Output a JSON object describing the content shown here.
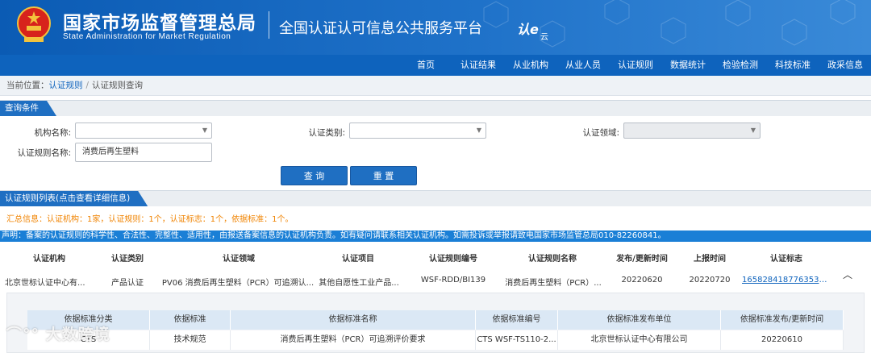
{
  "header": {
    "title_cn": "国家市场监督管理总局",
    "title_en": "State Administration  for  Market Regulation",
    "platform": "全国认证认可信息公共服务平台",
    "logo_text": "认e云"
  },
  "nav": {
    "items": [
      "首页",
      "认证结果",
      "从业机构",
      "从业人员",
      "认证规则",
      "数据统计",
      "检验检测",
      "科技标准",
      "政采信息"
    ]
  },
  "breadcrumb": {
    "prefix": "当前位置：",
    "level1": "认证规则",
    "separator": "/",
    "level2": "认证规则查询"
  },
  "query": {
    "section_title": "查询条件",
    "org_label": "机构名称:",
    "org_value": "",
    "type_label": "认证类别:",
    "type_value": "",
    "field_label": "认证领域:",
    "field_value": "",
    "rule_name_label": "认证规则名称:",
    "rule_name_value": "消费后再生塑料",
    "search_button": "查 询",
    "reset_button": "重 置"
  },
  "results": {
    "section_title": "认证规则列表(点击查看详细信息)",
    "summary": "汇总信息：认证机构：1家，认证规则：1个，认证标志：1个，依据标准：1个。",
    "notice": "声明：备案的认证规则的科学性、合法性、完整性、适用性，由报送备案信息的认证机构负责。如有疑问请联系相关认证机构。如需投诉或举报请致电国家市场监管总局010-82260841。",
    "columns": [
      "认证机构",
      "认证类别",
      "认证领域",
      "认证项目",
      "认证规则编号",
      "认证规则名称",
      "发布/更新时间",
      "上报时间",
      "认证标志"
    ],
    "rows": [
      {
        "org": "北京世标认证中心有...",
        "type": "产品认证",
        "field": "PV06 消费后再生塑料（PCR）可追溯认...",
        "project": "其他自愿性工业产品...",
        "code": "WSF-RDD/BI139",
        "name": "消费后再生塑料（PCR）...",
        "published": "20220620",
        "reported": "20220720",
        "mark": "1658284187763533..."
      }
    ]
  },
  "standards": {
    "columns": [
      "依据标准分类",
      "依据标准",
      "依据标准名称",
      "依据标准编号",
      "依据标准发布单位",
      "依据标准发布/更新时间"
    ],
    "rows": [
      {
        "category": "CTS",
        "basis": "技术规范",
        "name": "消费后再生塑料（PCR）可追溯评价要求",
        "number": "CTS WSF-TS110-2...",
        "publisher": "北京世标认证中心有限公司",
        "date": "20220610"
      }
    ]
  },
  "watermark": "大数跨境",
  "colors": {
    "brand_blue": "#0e63bd",
    "header_blue": "#1f72c9",
    "summary_orange": "#f08300",
    "notice_blue": "#1a7fd6"
  }
}
